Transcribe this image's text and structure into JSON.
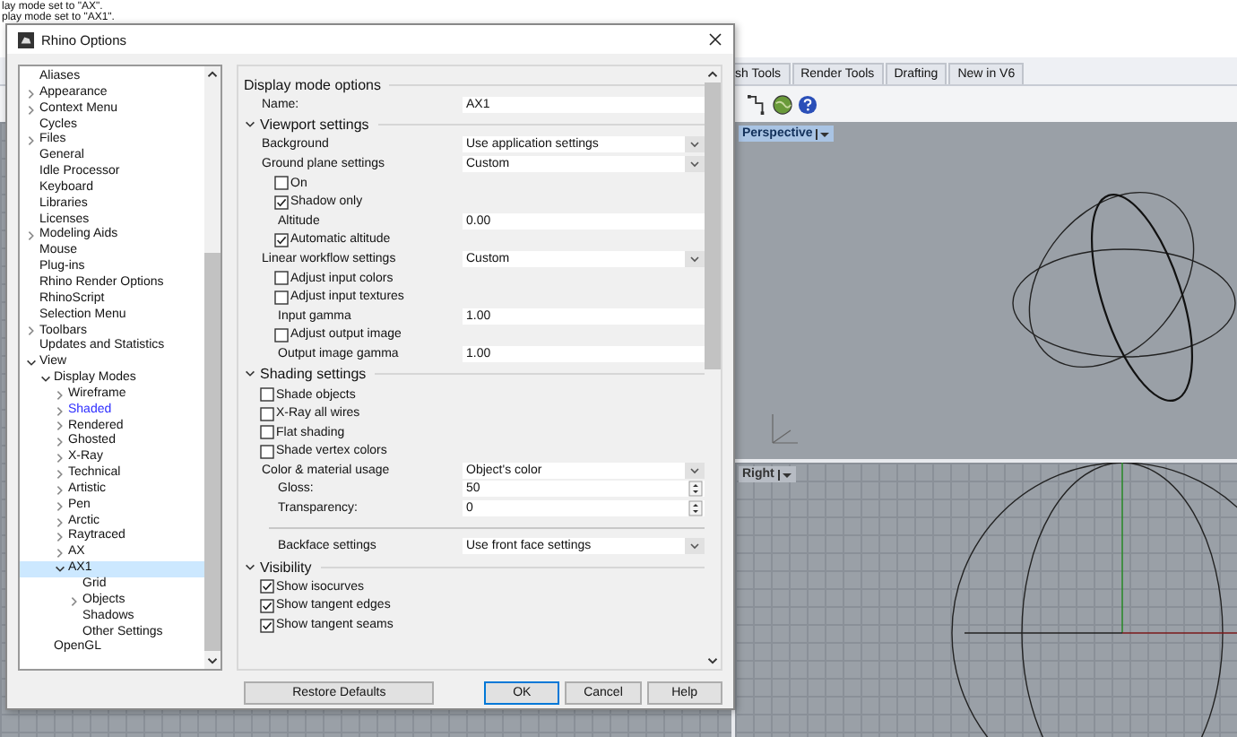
{
  "background_app": {
    "command_history": [
      "lay mode set to \"AX\".",
      "play mode set to \"AX1\"."
    ],
    "toolbar_tabs": [
      "sh Tools",
      "Render Tools",
      "Drafting",
      "New in V6"
    ],
    "viewports": [
      {
        "title": "Perspective",
        "selected": true
      },
      {
        "title": "Right",
        "selected": false
      }
    ]
  },
  "dialog": {
    "title": "Rhino Options",
    "tree": [
      {
        "label": "Aliases",
        "selected": false
      },
      {
        "label": "Appearance",
        "selected": false,
        "expanded": false
      },
      {
        "label": "Context Menu",
        "selected": false,
        "expanded": false
      },
      {
        "label": "Cycles",
        "selected": false
      },
      {
        "label": "Files",
        "selected": false,
        "expanded": false
      },
      {
        "label": "General",
        "selected": false
      },
      {
        "label": "Idle Processor",
        "selected": false
      },
      {
        "label": "Keyboard",
        "selected": false
      },
      {
        "label": "Libraries",
        "selected": false
      },
      {
        "label": "Licenses",
        "selected": false
      },
      {
        "label": "Modeling Aids",
        "selected": false,
        "expanded": false
      },
      {
        "label": "Mouse",
        "selected": false
      },
      {
        "label": "Plug-ins",
        "selected": false
      },
      {
        "label": "Rhino Render Options",
        "selected": false
      },
      {
        "label": "RhinoScript",
        "selected": false
      },
      {
        "label": "Selection Menu",
        "selected": false
      },
      {
        "label": "Toolbars",
        "selected": false,
        "expanded": false
      },
      {
        "label": "Updates and Statistics",
        "selected": false
      },
      {
        "label": "View",
        "selected": false,
        "expanded": true,
        "children": [
          {
            "label": "Display Modes",
            "selected": false,
            "expanded": true,
            "children": [
              {
                "label": "Wireframe",
                "selected": false,
                "expanded": false
              },
              {
                "label": "Shaded",
                "selected": false,
                "expanded": false,
                "color": "#2b2bff"
              },
              {
                "label": "Rendered",
                "selected": false,
                "expanded": false
              },
              {
                "label": "Ghosted",
                "selected": false,
                "expanded": false
              },
              {
                "label": "X-Ray",
                "selected": false,
                "expanded": false
              },
              {
                "label": "Technical",
                "selected": false,
                "expanded": false
              },
              {
                "label": "Artistic",
                "selected": false,
                "expanded": false
              },
              {
                "label": "Pen",
                "selected": false,
                "expanded": false
              },
              {
                "label": "Arctic",
                "selected": false,
                "expanded": false
              },
              {
                "label": "Raytraced",
                "selected": false,
                "expanded": false
              },
              {
                "label": "AX",
                "selected": false,
                "expanded": false
              },
              {
                "label": "AX1",
                "selected": true,
                "expanded": true,
                "children": [
                  {
                    "label": "Grid",
                    "selected": false
                  },
                  {
                    "label": "Objects",
                    "selected": false,
                    "expanded": false
                  },
                  {
                    "label": "Shadows",
                    "selected": false
                  },
                  {
                    "label": "Other Settings",
                    "selected": false
                  }
                ]
              }
            ]
          },
          {
            "label": "OpenGL",
            "selected": false
          }
        ]
      }
    ],
    "sections": [
      {
        "title": "Display mode options",
        "rows": [
          {
            "kind": "text",
            "label": "Name:",
            "value": "AX1"
          }
        ]
      },
      {
        "title": "Viewport settings",
        "expanded": true,
        "rows": [
          {
            "kind": "dropdown",
            "label": "Background",
            "value": "Use application settings"
          },
          {
            "kind": "dropdown",
            "label": "Ground plane settings",
            "value": "Custom",
            "children": [
              {
                "kind": "checkbox",
                "label": "On",
                "checked": false
              },
              {
                "kind": "checkbox",
                "label": "Shadow only",
                "checked": true
              },
              {
                "kind": "text",
                "label": "Altitude",
                "value": "0.00"
              },
              {
                "kind": "checkbox",
                "label": "Automatic altitude",
                "checked": true
              }
            ]
          },
          {
            "kind": "dropdown",
            "label": "Linear workflow settings",
            "value": "Custom",
            "children": [
              {
                "kind": "checkbox",
                "label": "Adjust input colors",
                "checked": false
              },
              {
                "kind": "checkbox",
                "label": "Adjust input textures",
                "checked": false
              },
              {
                "kind": "text",
                "label": "Input gamma",
                "value": "1.00"
              },
              {
                "kind": "checkbox",
                "label": "Adjust output image",
                "checked": false
              },
              {
                "kind": "text",
                "label": "Output image gamma",
                "value": "1.00"
              }
            ]
          }
        ]
      },
      {
        "title": "Shading settings",
        "expanded": true,
        "rows": [
          {
            "kind": "checkbox",
            "label": "Shade objects",
            "checked": false
          },
          {
            "kind": "checkbox",
            "label": "X-Ray all wires",
            "checked": false
          },
          {
            "kind": "checkbox",
            "label": "Flat shading",
            "checked": false
          },
          {
            "kind": "checkbox",
            "label": "Shade vertex colors",
            "checked": false
          },
          {
            "kind": "dropdown",
            "label": "Color & material usage",
            "value": "Object's color",
            "children": [
              {
                "kind": "spinner",
                "label": "Gloss:",
                "value": "50"
              },
              {
                "kind": "spinner",
                "label": "Transparency:",
                "value": "0"
              }
            ]
          },
          {
            "kind": "divider"
          },
          {
            "kind": "dropdown",
            "label": "Backface settings",
            "value": "Use front face settings",
            "indent": true
          }
        ]
      },
      {
        "title": "Visibility",
        "expanded": true,
        "rows": [
          {
            "kind": "checkbox",
            "label": "Show isocurves",
            "checked": true
          },
          {
            "kind": "checkbox",
            "label": "Show tangent edges",
            "checked": true
          },
          {
            "kind": "checkbox",
            "label": "Show tangent seams",
            "checked": true
          }
        ]
      }
    ],
    "buttons": [
      {
        "label": "Restore Defaults",
        "default": false
      },
      {
        "label": "OK",
        "default": true
      },
      {
        "label": "Cancel",
        "default": false
      },
      {
        "label": "Help",
        "default": false
      }
    ]
  }
}
